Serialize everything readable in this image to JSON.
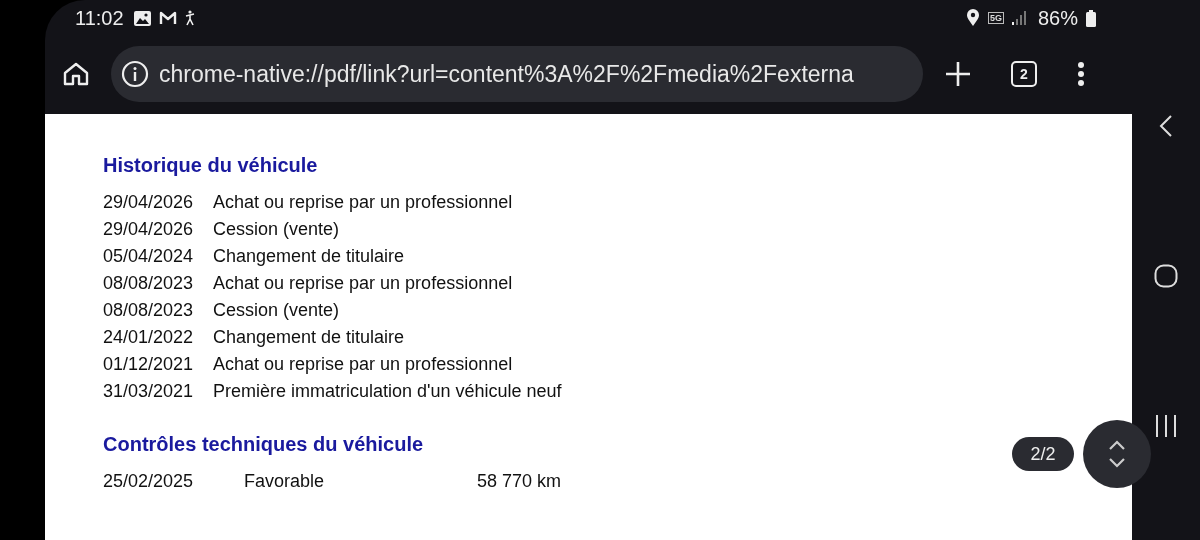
{
  "status_bar": {
    "time": "11:02",
    "network": "5G",
    "battery": "86%"
  },
  "toolbar": {
    "url": "chrome-native://pdf/link?url=content%3A%2F%2Fmedia%2Fexterna",
    "tab_count": "2"
  },
  "document": {
    "sections": [
      {
        "title": "Historique du véhicule",
        "kind": "history",
        "rows": [
          {
            "date": "29/04/2026",
            "event": "Achat ou reprise par un professionnel"
          },
          {
            "date": "29/04/2026",
            "event": "Cession (vente)"
          },
          {
            "date": "05/04/2024",
            "event": "Changement de titulaire"
          },
          {
            "date": "08/08/2023",
            "event": "Achat ou reprise par un professionnel"
          },
          {
            "date": "08/08/2023",
            "event": "Cession (vente)"
          },
          {
            "date": "24/01/2022",
            "event": "Changement de titulaire"
          },
          {
            "date": "01/12/2021",
            "event": "Achat ou reprise par un professionnel"
          },
          {
            "date": "31/03/2021",
            "event": "Première immatriculation d'un véhicule neuf"
          }
        ]
      },
      {
        "title": "Contrôles techniques du véhicule",
        "kind": "inspections",
        "rows": [
          {
            "date": "25/02/2025",
            "result": "Favorable",
            "mileage": "58 770 km"
          }
        ]
      }
    ]
  },
  "page_indicator": "2/2"
}
